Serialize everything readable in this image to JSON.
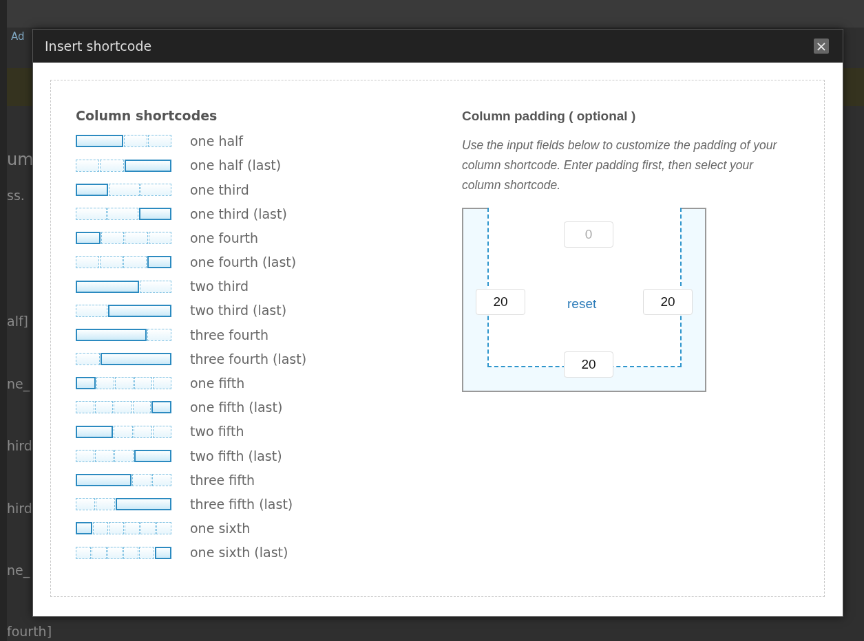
{
  "background_page": {
    "fragments": [
      {
        "text": "Ad",
        "kind": "link"
      },
      {
        "text": "um",
        "kind": "heading"
      },
      {
        "text": "ss.",
        "kind": "text"
      },
      {
        "text": "alf]",
        "kind": "text"
      },
      {
        "text": "ne_",
        "kind": "text"
      },
      {
        "text": "hird",
        "kind": "text"
      },
      {
        "text": "hird",
        "kind": "text"
      },
      {
        "text": "ne_",
        "kind": "text"
      },
      {
        "text": "fourth]",
        "kind": "text"
      }
    ]
  },
  "dialog": {
    "title": "Insert shortcode",
    "close": "×",
    "shortcodes": {
      "heading": "Column shortcodes",
      "items": [
        {
          "label": "one half",
          "kind": "half",
          "last": false
        },
        {
          "label": "one half (last)",
          "kind": "half",
          "last": true
        },
        {
          "label": "one third",
          "kind": "third",
          "last": false
        },
        {
          "label": "one third (last)",
          "kind": "third",
          "last": true
        },
        {
          "label": "one fourth",
          "kind": "fourth",
          "last": false
        },
        {
          "label": "one fourth (last)",
          "kind": "fourth",
          "last": true
        },
        {
          "label": "two third",
          "kind": "twothirds",
          "last": false
        },
        {
          "label": "two third (last)",
          "kind": "twothirds",
          "last": true
        },
        {
          "label": "three fourth",
          "kind": "threefourths",
          "last": false
        },
        {
          "label": "three fourth (last)",
          "kind": "threefourths",
          "last": true
        },
        {
          "label": "one fifth",
          "kind": "fifth",
          "last": false
        },
        {
          "label": "one fifth (last)",
          "kind": "fifth",
          "last": true
        },
        {
          "label": "two fifth",
          "kind": "twofifths",
          "last": false
        },
        {
          "label": "two fifth (last)",
          "kind": "twofifths",
          "last": true
        },
        {
          "label": "three fifth",
          "kind": "threefifths",
          "last": false
        },
        {
          "label": "three fifth (last)",
          "kind": "threefifths",
          "last": true
        },
        {
          "label": "one sixth",
          "kind": "sixth",
          "last": false
        },
        {
          "label": "one sixth (last)",
          "kind": "sixth",
          "last": true
        }
      ]
    },
    "padding": {
      "heading": "Column padding ( optional )",
      "description": "Use the input fields below to customize the padding of your column shortcode. Enter padding first, then select your column shortcode.",
      "top": {
        "placeholder": "0"
      },
      "left": {
        "value": "20"
      },
      "right": {
        "value": "20"
      },
      "bottom": {
        "value": "20"
      },
      "reset": "reset"
    }
  }
}
